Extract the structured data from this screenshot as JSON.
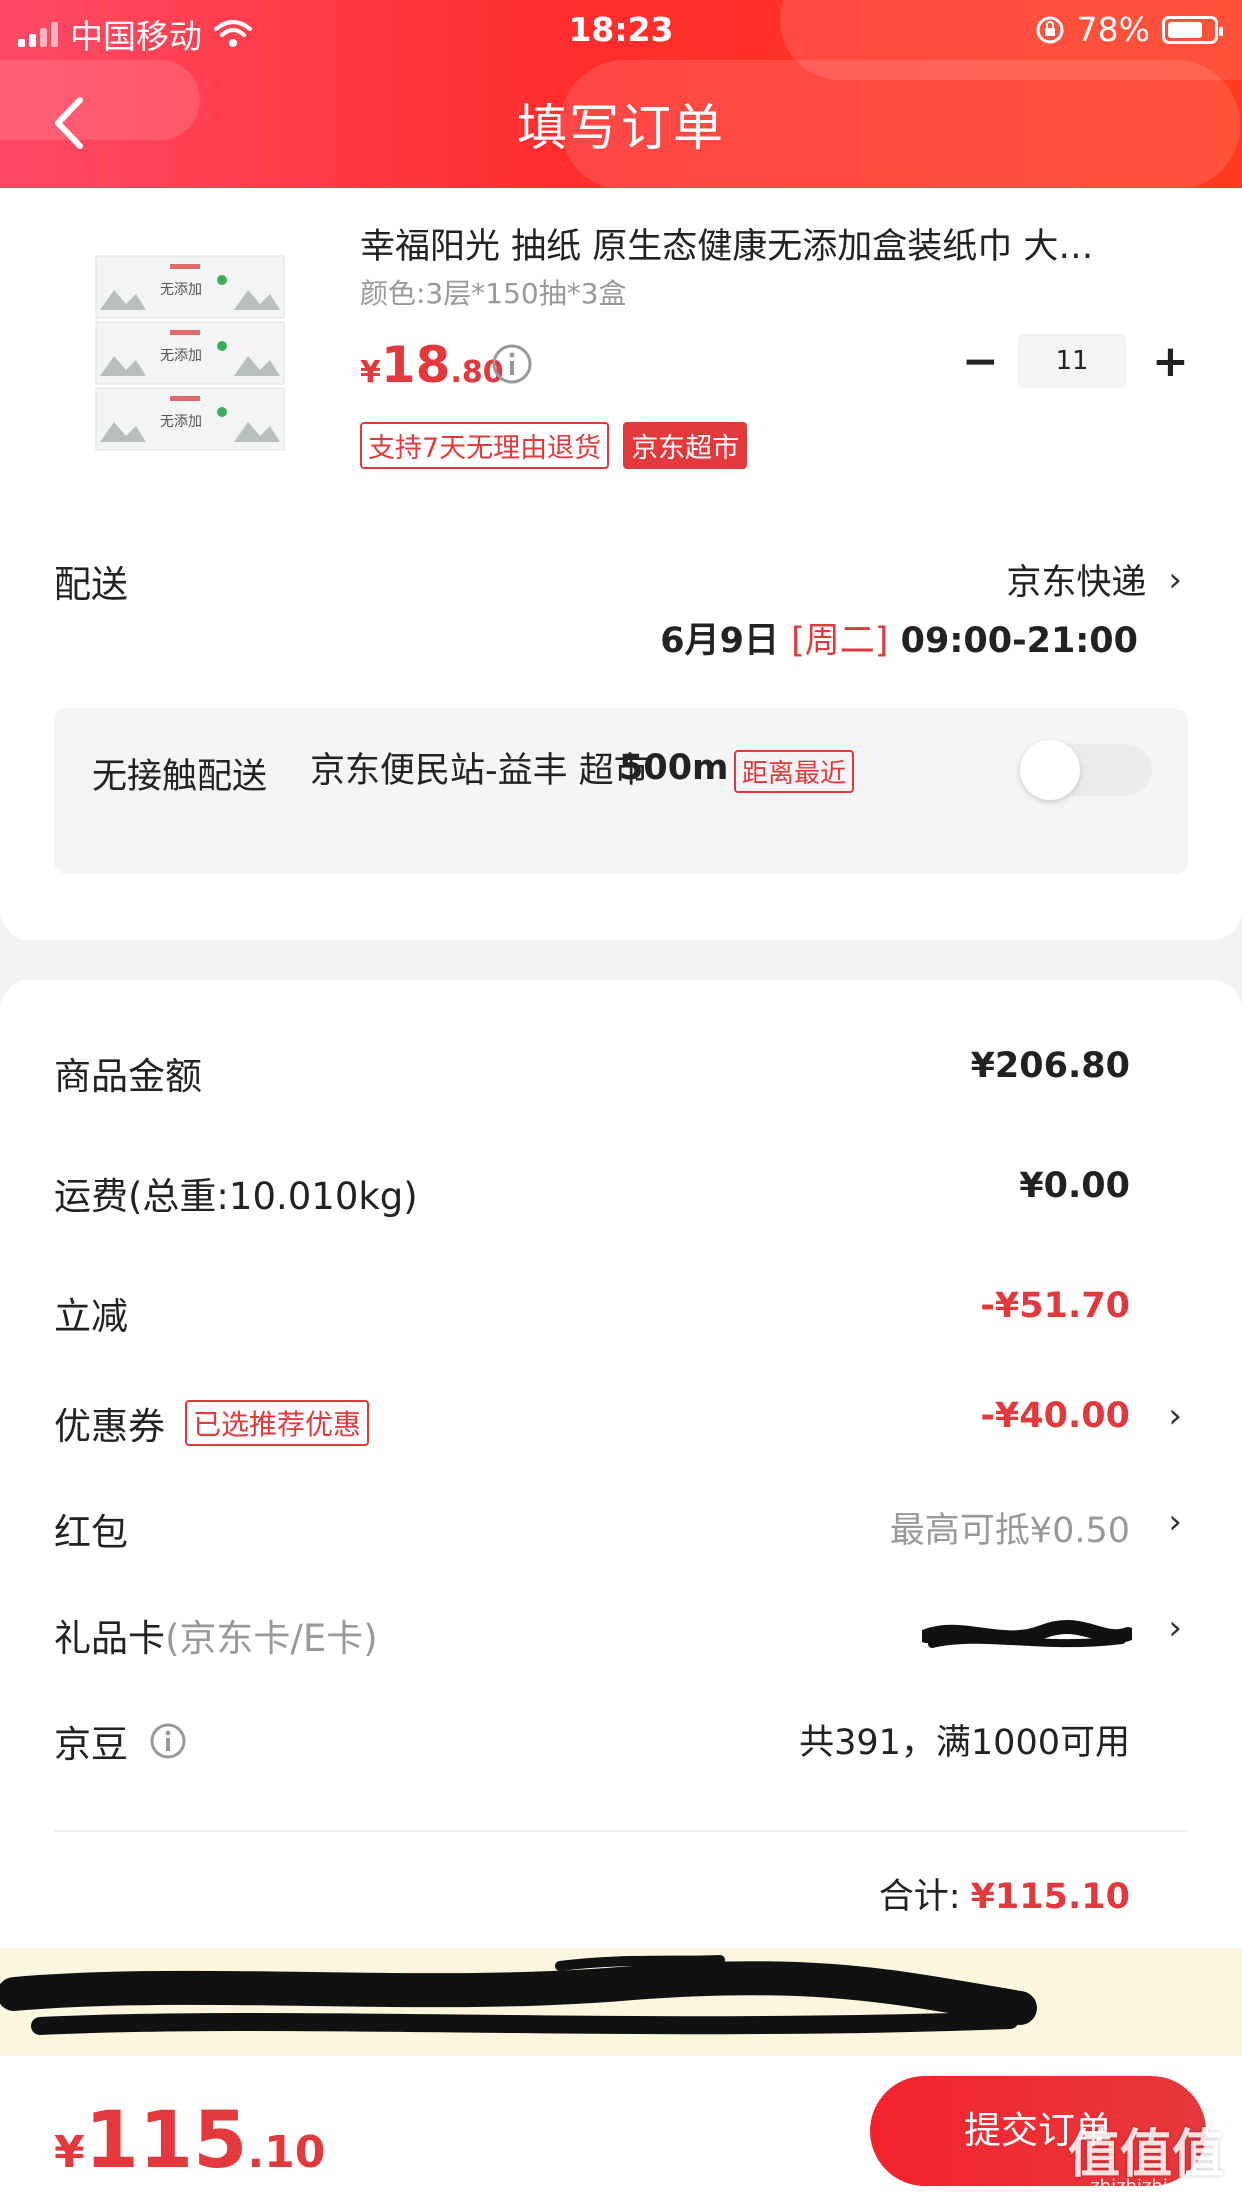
{
  "status_bar": {
    "carrier": "中国移动",
    "time": "18:23",
    "battery": "78%",
    "battery_level": 0.78
  },
  "header": {
    "title": "填写订单"
  },
  "product": {
    "title": "幸福阳光 抽纸 原生态健康无添加盒装纸巾 大…",
    "spec": "颜色:3层*150抽*3盒",
    "price_currency": "¥",
    "price_int": "18",
    "price_dec": ".80",
    "quantity": "11",
    "minus": "−",
    "plus": "+",
    "tags": [
      "支持7天无理由退货",
      "京东超市"
    ]
  },
  "delivery": {
    "label": "配送",
    "method": "京东快递",
    "date": "6月9日",
    "weekday": "[周二]",
    "time": "09:00-21:00"
  },
  "contactless": {
    "label": "无接触配送",
    "station": "京东便民站-益丰 超市",
    "distance": "500m",
    "tag": "距离最近",
    "enabled": false
  },
  "summary": {
    "rows": [
      {
        "label": "商品金额",
        "value": "¥206.80"
      },
      {
        "label": "运费(总重:10.010kg)",
        "value": "¥0.00"
      },
      {
        "label": "立减",
        "value": "-¥51.70"
      },
      {
        "label": "优惠券",
        "tag": "已选推荐优惠",
        "value": "-¥40.00"
      },
      {
        "label": "红包",
        "value": "最高可抵¥0.50"
      },
      {
        "label": "礼品卡",
        "sub": "(京东卡/E卡)"
      },
      {
        "label": "京豆",
        "value": "共391，满1000可用"
      }
    ],
    "total_label": "合计:",
    "total_value": "¥115.10"
  },
  "bottom": {
    "currency": "¥",
    "price_int": "115",
    "price_dec": ".10",
    "submit": "提交订单"
  },
  "watermark": {
    "main": "值值值",
    "sub": "zhizhizhi.com"
  },
  "colors": {
    "accent": "#e4393c",
    "header_start": "#ff4a67",
    "header_end": "#ff3b1f",
    "notice_bg": "#fcf6df"
  }
}
